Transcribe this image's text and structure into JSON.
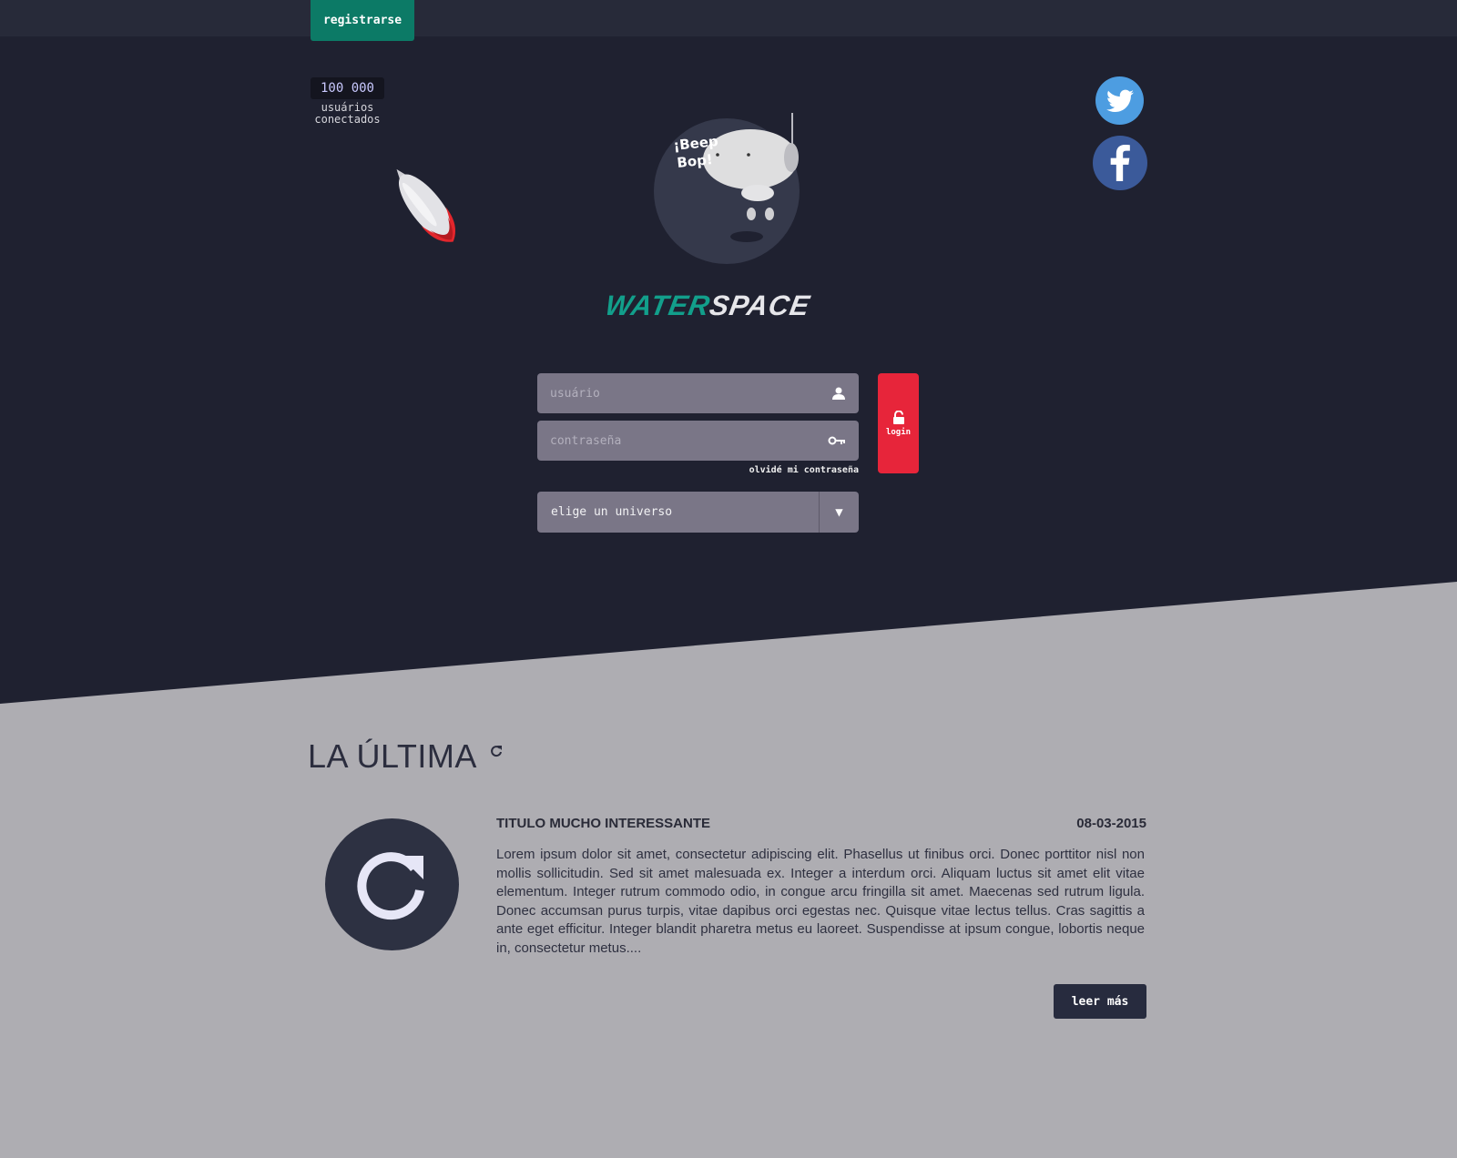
{
  "topbar": {
    "register_label": "registrarse"
  },
  "counter": {
    "value": "100 000",
    "label_line1": "usuários",
    "label_line2": "conectados"
  },
  "mascot": {
    "speech_line1": "¡Beep",
    "speech_line2": "Bop!"
  },
  "logo": {
    "part1": "WATER",
    "part2": "SPACE"
  },
  "login_form": {
    "username_placeholder": "usuário",
    "password_placeholder": "contraseña",
    "forgot_label": "olvidé mi contraseña",
    "universe_label": "elige un universo",
    "universe_arrow": "▼",
    "login_label": "login"
  },
  "social": {
    "twitter_icon": "twitter-icon",
    "facebook_icon": "facebook-icon"
  },
  "news": {
    "section_title": "LA ÚLTIMA",
    "title": "TITULO MUCHO INTERESSANTE",
    "date": "08-03-2015",
    "body": "Lorem ipsum dolor sit amet, consectetur adipiscing elit. Phasellus ut finibus orci. Donec porttitor nisl non mollis sollicitudin. Sed sit amet malesuada ex. Integer a interdum orci. Aliquam luctus sit amet elit vitae elementum. Integer rutrum commodo odio, in congue arcu fringilla sit amet. Maecenas sed rutrum ligula. Donec accumsan purus turpis, vitae dapibus orci egestas nec. Quisque vitae lectus tellus. Cras sagittis a ante eget efficitur. Integer blandit pharetra metus eu laoreet. Suspendisse at ipsum congue, lobortis neque in, consectetur metus....",
    "read_more_label": "leer más"
  },
  "colors": {
    "background_dark": "#1f2130",
    "background_light": "#aeadb2",
    "accent_green": "#0c7a66",
    "login_red": "#e7253a",
    "twitter_blue": "#4d9de1",
    "facebook_blue": "#3b5a9a"
  }
}
